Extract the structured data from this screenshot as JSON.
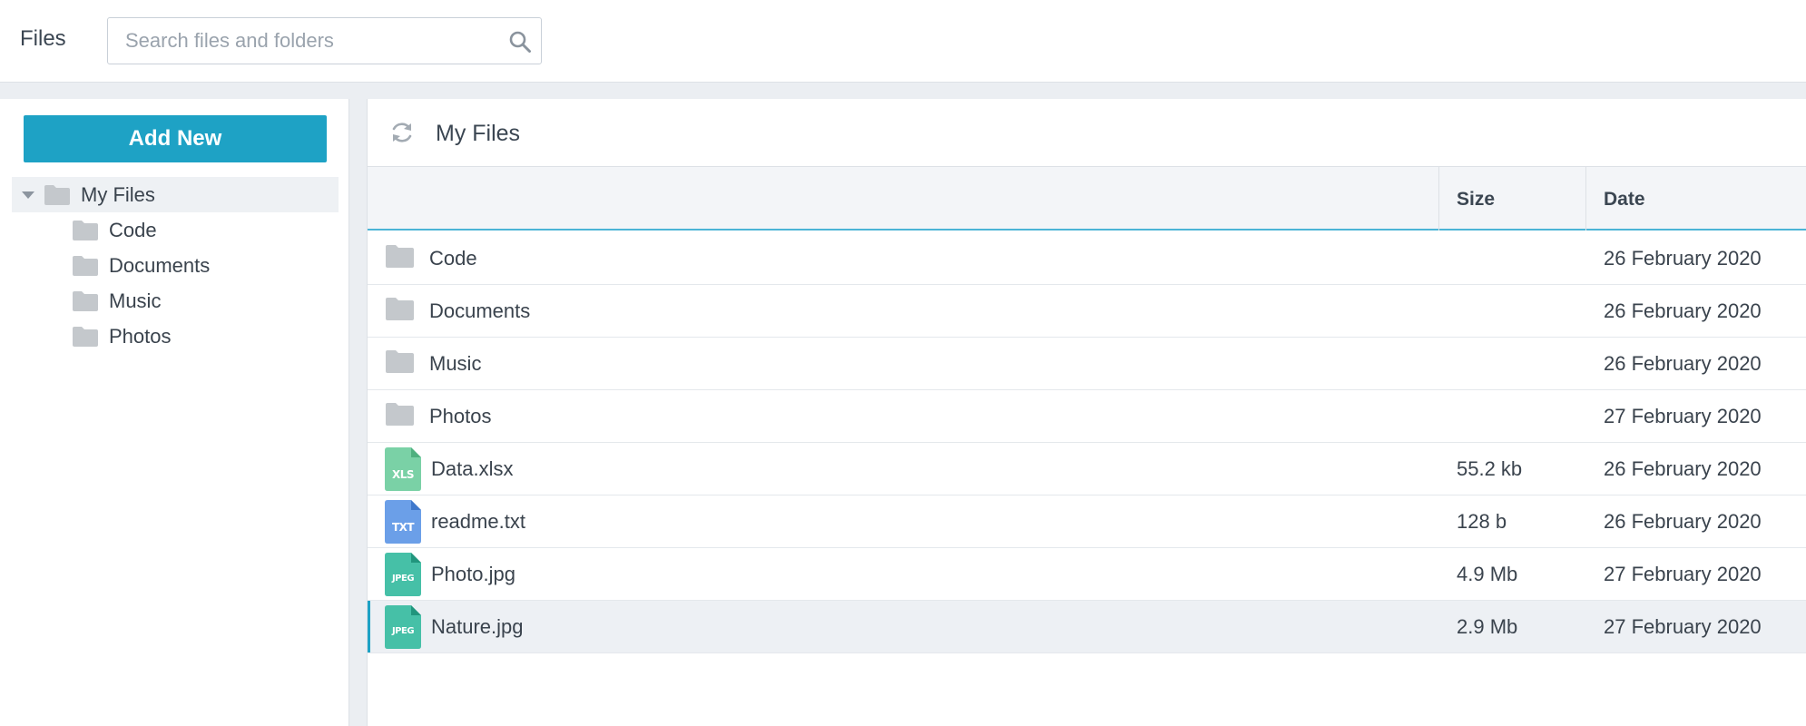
{
  "app": {
    "title": "Files"
  },
  "search": {
    "placeholder": "Search files and folders",
    "value": ""
  },
  "sidebar": {
    "add_new_label": "Add New",
    "root": {
      "label": "My Files"
    },
    "items": [
      {
        "label": "Code"
      },
      {
        "label": "Documents"
      },
      {
        "label": "Music"
      },
      {
        "label": "Photos"
      }
    ]
  },
  "main": {
    "title": "My Files",
    "columns": {
      "name": "",
      "size": "Size",
      "date": "Date"
    },
    "rows": [
      {
        "kind": "folder",
        "name": "Code",
        "size": "",
        "date": "26 February 2020"
      },
      {
        "kind": "folder",
        "name": "Documents",
        "size": "",
        "date": "26 February 2020"
      },
      {
        "kind": "folder",
        "name": "Music",
        "size": "",
        "date": "26 February 2020"
      },
      {
        "kind": "folder",
        "name": "Photos",
        "size": "",
        "date": "27 February 2020"
      },
      {
        "kind": "file",
        "badge": "XLS",
        "badge_color": "#7ad1a6",
        "name": "Data.xlsx",
        "size": "55.2 kb",
        "date": "26 February 2020"
      },
      {
        "kind": "file",
        "badge": "TXT",
        "badge_color": "#6b9fe8",
        "name": "readme.txt",
        "size": "128 b",
        "date": "26 February 2020"
      },
      {
        "kind": "file",
        "badge": "JPEG",
        "badge_color": "#46c0a7",
        "name": "Photo.jpg",
        "size": "4.9 Mb",
        "date": "27 February 2020"
      },
      {
        "kind": "file",
        "badge": "JPEG",
        "badge_color": "#46c0a7",
        "name": "Nature.jpg",
        "size": "2.9 Mb",
        "date": "27 February 2020",
        "selected": true
      }
    ]
  },
  "colors": {
    "accent": "#1ea2c5",
    "folder": "#c4c8cc",
    "header_underline": "#4bb4d6",
    "selected_row": "#edf0f4"
  },
  "icons": {
    "search": "search-icon",
    "refresh": "refresh-icon",
    "folder": "folder-icon",
    "caret": "caret-down-icon"
  }
}
